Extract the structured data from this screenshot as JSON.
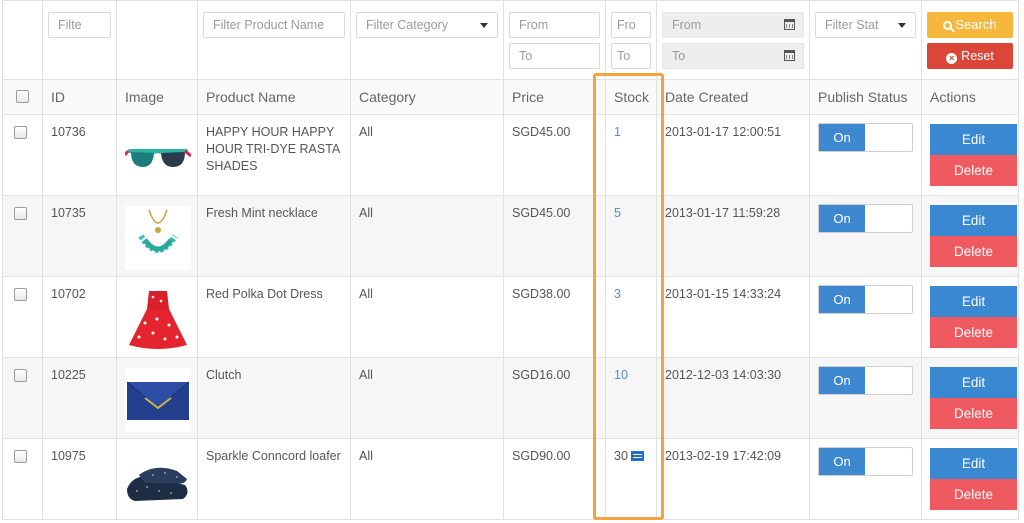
{
  "filters": {
    "id_placeholder": "Filte",
    "product_name_placeholder": "Filter Product Name",
    "category_placeholder": "Filter Category",
    "price_from_placeholder": "From",
    "price_to_placeholder": "To",
    "stock_from_placeholder": "Fro",
    "stock_to_placeholder": "To",
    "date_from_placeholder": "From",
    "date_to_placeholder": "To",
    "status_placeholder": "Filter Stat",
    "search_label": "Search",
    "reset_label": "Reset"
  },
  "columns": {
    "id": "ID",
    "image": "Image",
    "product_name": "Product Name",
    "category": "Category",
    "price": "Price",
    "stock": "Stock",
    "date_created": "Date Created",
    "publish_status": "Publish Status",
    "actions": "Actions"
  },
  "rows": [
    {
      "id": "10736",
      "image_icon": "sunglasses-image",
      "name": "HAPPY HOUR HAPPY HOUR TRI-DYE RASTA SHADES",
      "category": "All",
      "price": "SGD45.00",
      "stock": "1",
      "date": "2013-01-17 12:00:51",
      "status": "On",
      "edit": "Edit",
      "delete": "Delete"
    },
    {
      "id": "10735",
      "image_icon": "necklace-image",
      "name": "Fresh Mint necklace",
      "category": "All",
      "price": "SGD45.00",
      "stock": "5",
      "date": "2013-01-17 11:59:28",
      "status": "On",
      "edit": "Edit",
      "delete": "Delete"
    },
    {
      "id": "10702",
      "image_icon": "dress-image",
      "name": "Red Polka Dot Dress",
      "category": "All",
      "price": "SGD38.00",
      "stock": "3",
      "date": "2013-01-15 14:33:24",
      "status": "On",
      "edit": "Edit",
      "delete": "Delete"
    },
    {
      "id": "10225",
      "image_icon": "clutch-image",
      "name": "Clutch",
      "category": "All",
      "price": "SGD16.00",
      "stock": "10",
      "date": "2012-12-03 14:03:30",
      "status": "On",
      "edit": "Edit",
      "delete": "Delete"
    },
    {
      "id": "10975",
      "image_icon": "loafer-image",
      "name": "Sparkle Conncord loafer",
      "category": "All",
      "price": "SGD90.00",
      "stock": "30",
      "date": "2013-02-19 17:42:09",
      "status": "On",
      "edit": "Edit",
      "delete": "Delete"
    }
  ],
  "colors": {
    "highlight": "#f4a340",
    "toggle_on": "#3d88cf",
    "edit": "#3a87d2",
    "delete": "#ef5a60",
    "search": "#f5b83d",
    "reset": "#dc4638"
  }
}
